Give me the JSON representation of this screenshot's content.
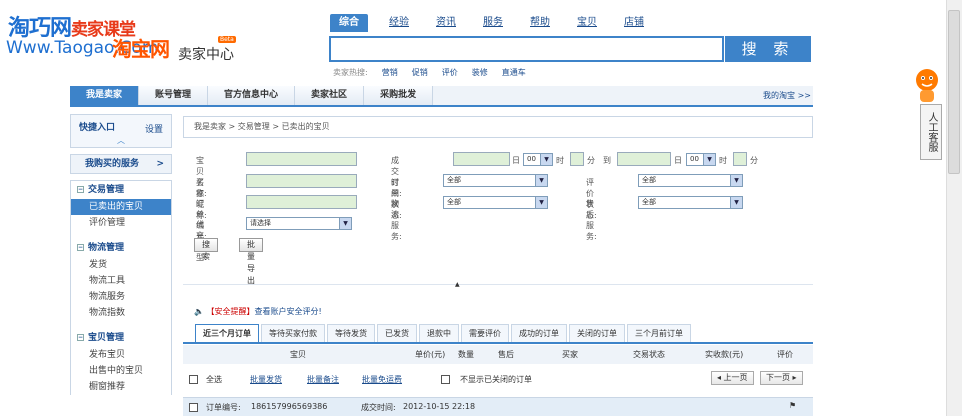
{
  "header": {
    "watermark_top": "淘巧网",
    "watermark_red": "卖家课堂",
    "watermark_url": "Www.Taogao.Com",
    "logo_text": "淘宝网",
    "logo_sub": "卖家中心",
    "beta": "Beta"
  },
  "search": {
    "tabs": [
      "综合",
      "经验",
      "资讯",
      "服务",
      "帮助",
      "宝贝",
      "店铺"
    ],
    "button": "搜 索",
    "hot_label": "卖家热搜:",
    "hot_terms": [
      "营销",
      "促销",
      "评价",
      "装修",
      "直通车"
    ]
  },
  "topnav": {
    "items": [
      "我是卖家",
      "账号管理",
      "官方信息中心",
      "卖家社区",
      "采购批发"
    ],
    "right_link": "我的淘宝 >>"
  },
  "sidebar": {
    "shortcut_title": "快捷入口",
    "shortcut_settings": "设置",
    "shortcut_chevron": "︿",
    "bought": "我购买的服务",
    "bought_arrow": ">",
    "groups": [
      {
        "title": "交易管理",
        "items": [
          "已卖出的宝贝",
          "评价管理"
        ]
      },
      {
        "title": "物流管理",
        "items": [
          "发货",
          "物流工具",
          "物流服务",
          "物流指数"
        ]
      },
      {
        "title": "宝贝管理",
        "items": [
          "发布宝贝",
          "出售中的宝贝",
          "橱窗推荐"
        ]
      }
    ]
  },
  "breadcrumb": [
    "我是卖家",
    "交易管理",
    "已卖出的宝贝"
  ],
  "form": {
    "item_name": "宝贝名称:",
    "buyer": "买家昵称:",
    "order_no": "订单编号:",
    "agent_type": "代充类型:",
    "agent_value": "请选择",
    "deal_time": "成交时间: 从",
    "day": "日",
    "hour_value": "00",
    "hour": "时",
    "minute": "分",
    "to": "到",
    "order_status": "订单状态:",
    "logistics": "物流服务:",
    "review_status": "评价状态:",
    "aftersale": "售后服务:",
    "all": "全部",
    "search_btn": "搜索",
    "export_btn": "批量导出"
  },
  "alert": {
    "tag": "【安全提醒】",
    "text": "查看账户安全评分!"
  },
  "order_tabs": [
    "近三个月订单",
    "等待买家付款",
    "等待发货",
    "已发货",
    "退款中",
    "需要评价",
    "成功的订单",
    "关闭的订单",
    "三个月前订单"
  ],
  "table_header": [
    "宝贝",
    "单价(元)",
    "数量",
    "售后",
    "买家",
    "交易状态",
    "实收款(元)",
    "评价"
  ],
  "toolbar": {
    "select_all": "全选",
    "batch_ship": "批量发货",
    "batch_memo": "批量备注",
    "free_review": "批量免运费",
    "hide_closed": "不显示已关闭的订单",
    "prev": "◂ 上一页",
    "next": "下一页 ▸"
  },
  "order": {
    "no_label": "订单编号:",
    "no": "186157996569386",
    "time_label": "成交时间:",
    "time": "2012-10-15 22:18"
  },
  "service": {
    "label": "人工客服"
  }
}
